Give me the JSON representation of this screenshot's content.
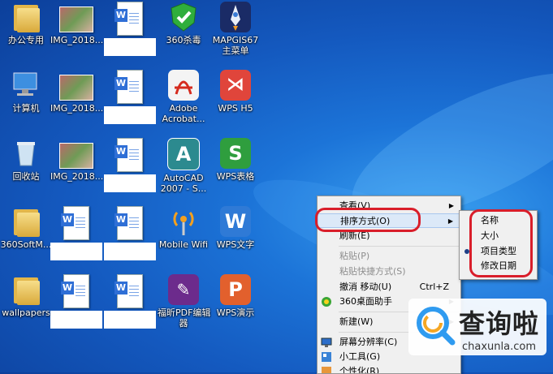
{
  "desktop": {
    "icons": [
      {
        "label": "办公专用",
        "kind": "folder-icon"
      },
      {
        "label": "IMG_2018...",
        "kind": "photo-icon"
      },
      {
        "label": "",
        "kind": "word-doc-icon"
      },
      {
        "label": "360杀毒",
        "kind": "shield-icon"
      },
      {
        "label": "MAPGIS67\n主菜单",
        "kind": "rocket-icon"
      },
      {
        "label": "计算机",
        "kind": "computer-icon"
      },
      {
        "label": "IMG_2018...",
        "kind": "photo-icon"
      },
      {
        "label": "",
        "kind": "word-doc-icon"
      },
      {
        "label": "Adobe\nAcrobat...",
        "kind": "acrobat-icon"
      },
      {
        "label": "WPS H5",
        "kind": "wps-h5-icon"
      },
      {
        "label": "回收站",
        "kind": "recycle-bin-icon"
      },
      {
        "label": "IMG_2018...",
        "kind": "photo-icon"
      },
      {
        "label": "",
        "kind": "word-doc-icon"
      },
      {
        "label": "AutoCAD\n2007 - S...",
        "kind": "autocad-icon"
      },
      {
        "label": "WPS表格",
        "kind": "wps-sheet-icon"
      },
      {
        "label": "360SoftM...",
        "kind": "folder-icon"
      },
      {
        "label": "",
        "kind": "word-doc-icon"
      },
      {
        "label": "",
        "kind": "word-doc-icon"
      },
      {
        "label": "Mobile Wifi",
        "kind": "wifi-icon"
      },
      {
        "label": "WPS文字",
        "kind": "wps-writer-icon"
      },
      {
        "label": "wallpapers",
        "kind": "folder-icon"
      },
      {
        "label": "",
        "kind": "word-doc-icon"
      },
      {
        "label": "",
        "kind": "word-doc-icon"
      },
      {
        "label": "福昕PDF编辑\n器",
        "kind": "foxit-icon"
      },
      {
        "label": "WPS演示",
        "kind": "wps-ppt-icon"
      }
    ]
  },
  "context_menu": {
    "items": [
      {
        "label": "查看(V)",
        "submenu": true
      },
      {
        "label": "排序方式(O)",
        "submenu": true,
        "highlighted": true
      },
      {
        "label": "刷新(E)"
      },
      {
        "label": "粘贴(P)",
        "disabled": true
      },
      {
        "label": "粘贴快捷方式(S)",
        "disabled": true
      },
      {
        "label": "撤消 移动(U)",
        "shortcut": "Ctrl+Z"
      },
      {
        "label": "360桌面助手",
        "submenu": true
      },
      {
        "label": "新建(W)",
        "submenu": true
      },
      {
        "label": "屏幕分辨率(C)"
      },
      {
        "label": "小工具(G)"
      },
      {
        "label": "个性化(R)"
      }
    ]
  },
  "sort_submenu": {
    "items": [
      "名称",
      "大小",
      "项目类型",
      "修改日期"
    ]
  },
  "watermark": {
    "name": "查询啦",
    "url": "chaxunla.com"
  },
  "colors": {
    "highlight_ring": "#d91e2a",
    "desktop_blue": "#1c74d8"
  }
}
